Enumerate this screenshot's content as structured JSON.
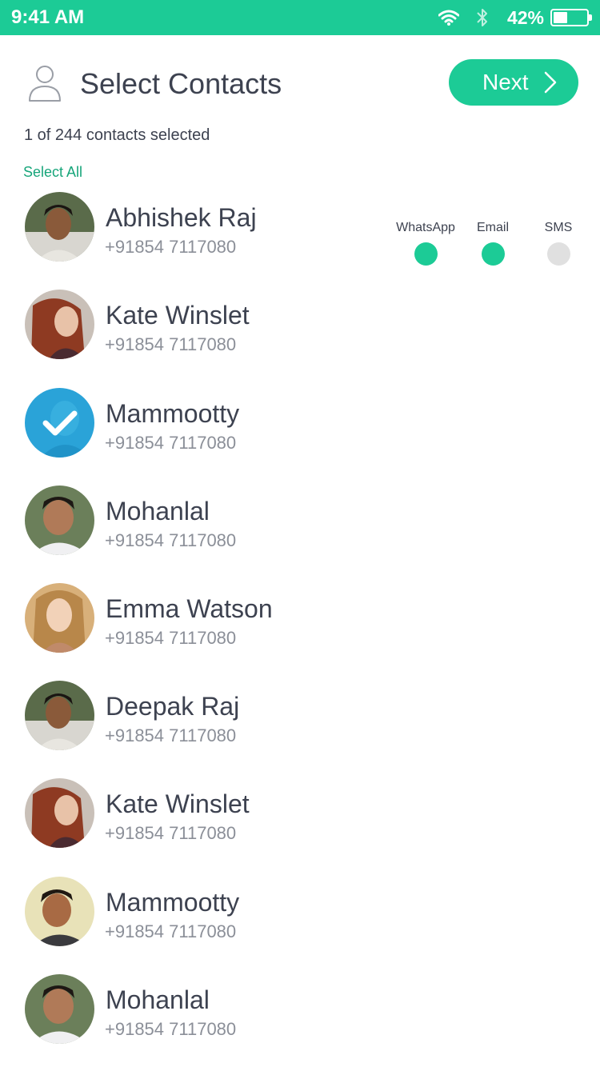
{
  "status_bar": {
    "time": "9:41 AM",
    "battery_percent": "42%",
    "battery_level": 0.42,
    "icons": [
      "wifi-icon",
      "bluetooth-icon",
      "battery-icon"
    ]
  },
  "header": {
    "title": "Select Contacts",
    "next_label": "Next",
    "icons": [
      "user-icon",
      "chevron-right-icon"
    ]
  },
  "selection": {
    "count_text": "1 of 244 contacts selected",
    "select_all_label": "Select All"
  },
  "contacts": [
    {
      "name": "Abhishek Raj",
      "phone": "+91854 7117080",
      "selected": false
    },
    {
      "name": "Kate Winslet",
      "phone": "+91854 7117080",
      "selected": false
    },
    {
      "name": "Mammootty",
      "phone": "+91854 7117080",
      "selected": true
    },
    {
      "name": "Mohanlal",
      "phone": "+91854 7117080",
      "selected": false
    },
    {
      "name": "Emma Watson",
      "phone": "+91854 7117080",
      "selected": false
    },
    {
      "name": "Deepak Raj",
      "phone": "+91854 7117080",
      "selected": false
    },
    {
      "name": "Kate Winslet",
      "phone": "+91854 7117080",
      "selected": false
    },
    {
      "name": "Mammootty",
      "phone": "+91854 7117080",
      "selected": false
    },
    {
      "name": "Mohanlal",
      "phone": "+91854 7117080",
      "selected": false
    }
  ],
  "channels": [
    {
      "label": "WhatsApp",
      "active": true
    },
    {
      "label": "Email",
      "active": true
    },
    {
      "label": "SMS",
      "active": false
    }
  ],
  "colors": {
    "accent": "#1ccb96",
    "accent_text": "#17a57a",
    "inactive_dot": "#e0e0e0",
    "selected_avatar": "#2aa3d8"
  }
}
